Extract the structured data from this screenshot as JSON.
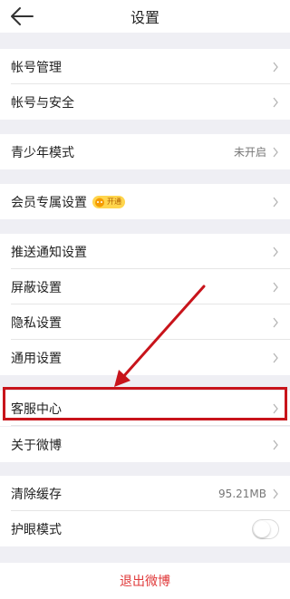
{
  "header": {
    "title": "设置",
    "back_icon": "back-arrow-icon"
  },
  "groups": {
    "account": {
      "manage": "帐号管理",
      "security": "帐号与安全"
    },
    "youth": {
      "label": "青少年模式",
      "status": "未开启"
    },
    "vip": {
      "label": "会员专属设置",
      "badge_text": "开通"
    },
    "settings": {
      "push": "推送通知设置",
      "block": "屏蔽设置",
      "privacy": "隐私设置",
      "general": "通用设置"
    },
    "support": {
      "service": "客服中心",
      "about": "关于微博"
    },
    "storage": {
      "clear_cache": "清除缓存",
      "cache_size": "95.21MB",
      "eye_mode": "护眼模式",
      "eye_mode_on": false
    }
  },
  "logout_label": "退出微博",
  "colors": {
    "annotation": "#c8141b",
    "logout": "#e0393a",
    "background": "#efeff4"
  }
}
